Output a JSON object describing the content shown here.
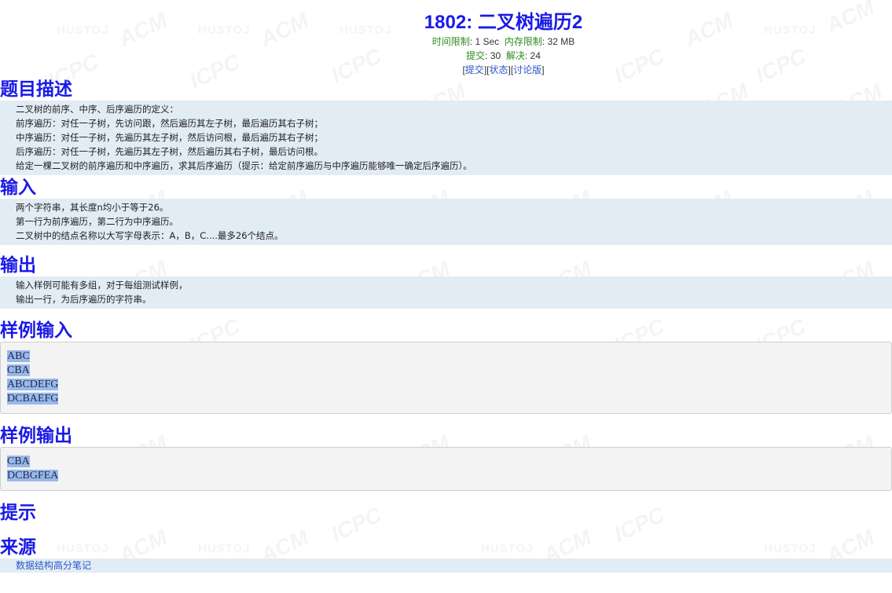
{
  "problem": {
    "title": "1802: 二叉树遍历2",
    "time_limit_label": "时间限制",
    "time_limit_value": "1 Sec",
    "memory_limit_label": "内存限制",
    "memory_limit_value": "32 MB",
    "submit_count_label": "提交",
    "submit_count_value": "30",
    "solved_count_label": "解决",
    "solved_count_value": "24",
    "links": {
      "submit": "提交",
      "status": "状态",
      "discuss": "讨论版"
    }
  },
  "sections": {
    "description": {
      "heading": "题目描述",
      "lines": [
        "二叉树的前序、中序、后序遍历的定义：",
        "前序遍历：对任一子树，先访问跟，然后遍历其左子树，最后遍历其右子树；",
        "中序遍历：对任一子树，先遍历其左子树，然后访问根，最后遍历其右子树；",
        "后序遍历：对任一子树，先遍历其左子树，然后遍历其右子树，最后访问根。",
        "给定一棵二叉树的前序遍历和中序遍历，求其后序遍历（提示：给定前序遍历与中序遍历能够唯一确定后序遍历）。"
      ]
    },
    "input": {
      "heading": "输入",
      "lines": [
        "两个字符串，其长度n均小于等于26。",
        "第一行为前序遍历，第二行为中序遍历。",
        "二叉树中的结点名称以大写字母表示：A，B，C....最多26个结点。"
      ]
    },
    "output": {
      "heading": "输出",
      "lines": [
        "输入样例可能有多组，对于每组测试样例，",
        "输出一行，为后序遍历的字符串。"
      ]
    },
    "sample_input": {
      "heading": "样例输入",
      "lines": [
        "ABC",
        "CBA",
        "ABCDEFG",
        "DCBAEFG"
      ]
    },
    "sample_output": {
      "heading": "样例输出",
      "lines": [
        "CBA",
        "DCBGFEA"
      ]
    },
    "hint": {
      "heading": "提示"
    },
    "source": {
      "heading": "来源",
      "text": "数据结构高分笔记"
    }
  },
  "watermark": {
    "text_1": "HUSTOJ",
    "text_2": "ACM",
    "text_3": "ICPC"
  },
  "colors": {
    "heading": "#1a1ae6",
    "meta_label": "#2e8b1f",
    "link": "#2857c5",
    "section_bg": "#e2ecf5",
    "sample_bg": "#f3f3f3",
    "selection": "#99b8e6"
  }
}
